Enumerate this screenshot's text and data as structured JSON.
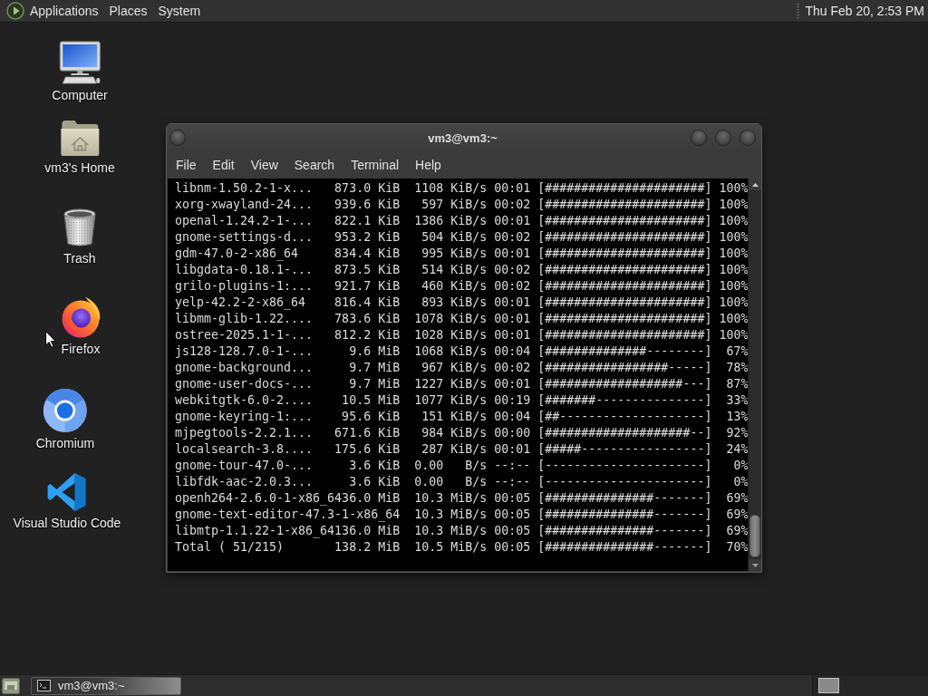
{
  "top_panel": {
    "menus": [
      "Applications",
      "Places",
      "System"
    ],
    "clock": "Thu Feb 20, 2:53 PM"
  },
  "desktop": {
    "shortcuts": [
      {
        "label": "Computer",
        "kind": "computer"
      },
      {
        "label": "vm3's Home",
        "kind": "home"
      },
      {
        "label": "Trash",
        "kind": "trash"
      },
      {
        "label": "Firefox",
        "kind": "firefox"
      },
      {
        "label": "Chromium",
        "kind": "chromium"
      },
      {
        "label": "Visual Studio Code",
        "kind": "vscode"
      }
    ]
  },
  "terminal": {
    "title": "vm3@vm3:~",
    "menu": [
      "File",
      "Edit",
      "View",
      "Search",
      "Terminal",
      "Help"
    ],
    "lines": [
      "libnm-1.50.2-1-x...   873.0 KiB  1108 KiB/s 00:01 [######################] 100%",
      "xorg-xwayland-24...   939.6 KiB   597 KiB/s 00:02 [######################] 100%",
      "openal-1.24.2-1-...   822.1 KiB  1386 KiB/s 00:01 [######################] 100%",
      "gnome-settings-d...   953.2 KiB   504 KiB/s 00:02 [######################] 100%",
      "gdm-47.0-2-x86_64     834.4 KiB   995 KiB/s 00:01 [######################] 100%",
      "libgdata-0.18.1-...   873.5 KiB   514 KiB/s 00:02 [######################] 100%",
      "grilo-plugins-1:...   921.7 KiB   460 KiB/s 00:02 [######################] 100%",
      "yelp-42.2-2-x86_64    816.4 KiB   893 KiB/s 00:01 [######################] 100%",
      "libmm-glib-1.22....   783.6 KiB  1078 KiB/s 00:01 [######################] 100%",
      "ostree-2025.1-1-...   812.2 KiB  1028 KiB/s 00:01 [######################] 100%",
      "js128-128.7.0-1-...     9.6 MiB  1068 KiB/s 00:04 [##############--------]  67%",
      "gnome-background...     9.7 MiB   967 KiB/s 00:02 [#################-----]  78%",
      "gnome-user-docs-...     9.7 MiB  1227 KiB/s 00:01 [###################---]  87%",
      "webkitgtk-6.0-2....    10.5 MiB  1077 KiB/s 00:19 [#######---------------]  33%",
      "gnome-keyring-1:...    95.6 KiB   151 KiB/s 00:04 [##--------------------]  13%",
      "mjpegtools-2.2.1...   671.6 KiB   984 KiB/s 00:00 [####################--]  92%",
      "localsearch-3.8....   175.6 KiB   287 KiB/s 00:01 [#####-----------------]  24%",
      "gnome-tour-47.0-...     3.6 KiB  0.00   B/s --:-- [----------------------]   0%",
      "libfdk-aac-2.0.3...     3.6 KiB  0.00   B/s --:-- [----------------------]   0%",
      "openh264-2.6.0-1-x86_6436.0 MiB  10.3 MiB/s 00:05 [###############-------]  69%",
      "gnome-text-editor-47.3-1-x86_64  10.3 MiB/s 00:05 [###############-------]  69%",
      "libmtp-1.1.22-1-x86_64136.0 MiB  10.3 MiB/s 00:05 [###############-------]  69%",
      "Total ( 51/215)       138.2 MiB  10.5 MiB/s 00:05 [###############-------]  70%"
    ]
  },
  "taskbar": {
    "tasks": [
      {
        "label": "vm3@vm3:~",
        "selected": true
      }
    ]
  }
}
